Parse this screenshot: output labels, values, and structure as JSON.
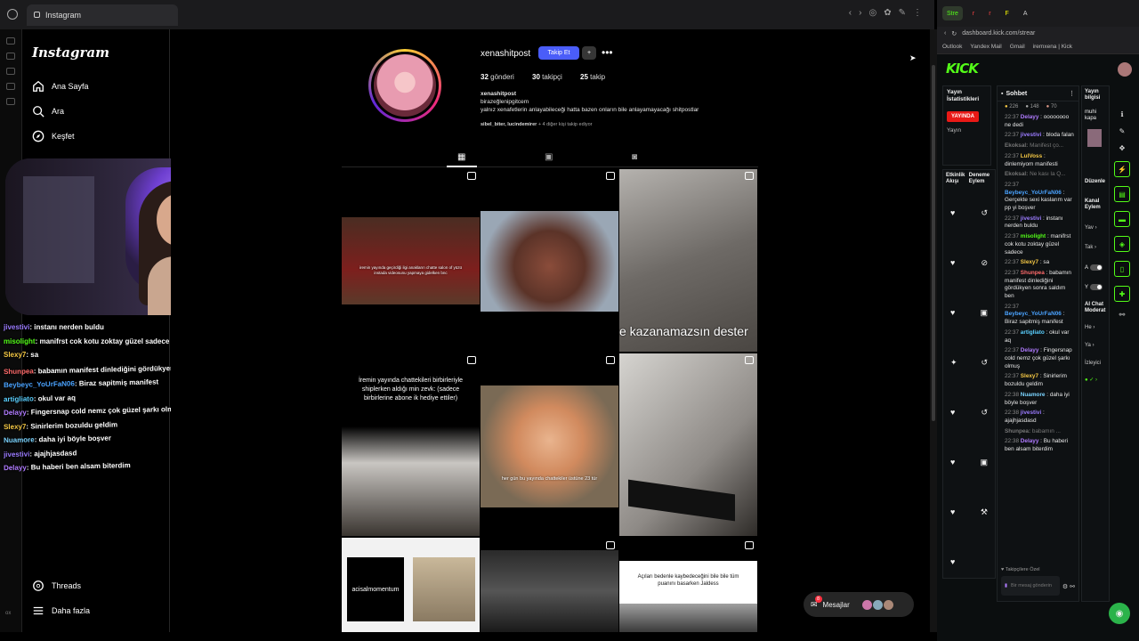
{
  "browser": {
    "tab_title": "Instagram"
  },
  "ig": {
    "logo": "Instagram",
    "nav": [
      "Ana Sayfa",
      "Ara",
      "Keşfet"
    ],
    "nav_bottom": [
      "Threads",
      "Daha fazla"
    ],
    "username": "xenashitpost",
    "follow_btn": "Takip Et",
    "stats": {
      "posts": "32",
      "posts_label": "gönderi",
      "followers": "30",
      "followers_label": "takipçi",
      "following": "25",
      "following_label": "takip"
    },
    "bio_name": "xenashitpost",
    "bio_lines": [
      "birazeğlenipgitcem",
      "yalnız xenafetlerin anlayabileceği hatta bazen onların bile anlayamayacağı shitpostlar"
    ],
    "followed_by_names": "sibel_biter, lucindemirer",
    "followed_by_rest": "+ 4 diğer kişi takip ediyor",
    "messages": "Mesajlar",
    "messages_badge": "8"
  },
  "posts": {
    "p1_cap": "iremin yayında geçirdiği ilgi anakların chatte salon of yüzü instada videosunu yapmaya gidelken bnc",
    "p3_cap": "e kazanamazsın dester",
    "p4_cap": "İremin yayında chattekileri birbirleriyle shiplerken aldığı min zevk: (sadece birbirlerine abone ik hediye ettiler)",
    "p5_cap": "her gün bu yayında chattekiler üstüne 23 tür",
    "p7_cap": "acisalmomentum",
    "p9_cap": "Açıları bedenle kaybedeceğini bile bile tüm puanını basarken Jaldess"
  },
  "overlay_chat": [
    {
      "user": "jivestivi",
      "text": ": instanı nerden buldu",
      "color": "#9b7bff"
    },
    {
      "user": "misolight",
      "text": ": manifrst cok kotu zoktay güzel sadece",
      "color": "#53fc18"
    },
    {
      "user": "Slexy7",
      "text": ": sa",
      "color": "#f6c945"
    },
    {
      "user": "Shunpea",
      "text": ": babamın manifest dinlediğini gördükyen sonra saldım ben",
      "color": "#ff6b6b"
    },
    {
      "user": "Beybeyc_YoUrFaN06",
      "text": ": Biraz sapitmiş manifest",
      "color": "#4aa3ff"
    },
    {
      "user": "artigliato",
      "text": ": okul var aq",
      "color": "#5ad0ff"
    },
    {
      "user": "Delayy",
      "text": ": Fingersnap cold nemz çok güzel şarkı olmuş",
      "color": "#b07bff"
    },
    {
      "user": "Slexy7",
      "text": ": Sinirlerim bozuldu geldim",
      "color": "#f6c945"
    },
    {
      "user": "Nuamore",
      "text": ": daha iyi böyle boşver",
      "color": "#7bd4ff"
    },
    {
      "user": "jivestivi",
      "text": ": ajajhjasdasd",
      "color": "#9b7bff"
    },
    {
      "user": "Delayy",
      "text": ": Bu haberi ben alsam biterdim",
      "color": "#b07bff"
    }
  ],
  "kick": {
    "tabs": [
      "Stre",
      "r",
      "r",
      "F",
      "A"
    ],
    "url": "dashboard.kick.com/strear",
    "bookmarks": [
      "Outlook",
      "Yandex Mail",
      "Gmail",
      "iremxena | Kick"
    ],
    "logo": "KICK",
    "stats_title": "Yayın İstatistikleri",
    "live": "YAYINDA",
    "yayin": "Yayın",
    "events_title": "Etkinlik Akışı",
    "events_title2": "Deneme Eylem",
    "chat_title": "Sohbet",
    "viewers": [
      "226",
      "148",
      "70"
    ],
    "info_title": "Yayın bilgisi",
    "info_sub": "muhi kapa",
    "duzenle": "Düzenle",
    "channel_actions": "Kanal Eylem",
    "rows": [
      "Yav",
      "Tak",
      "A",
      "Y"
    ],
    "ai_chat": "AI Chat Moderat",
    "he": "He",
    "ya": "Ya",
    "izleyici": "İzleyici",
    "followers_only": "Takipçilere Özel",
    "send_hint": "Bir mesaj gönderin",
    "chat": [
      {
        "t": "22:37",
        "u": "Delayy",
        "m": ": oooooooo ne dedi",
        "c": "#b07bff"
      },
      {
        "t": "22:37",
        "u": "jivestivi",
        "m": ": bloda falan",
        "c": "#9b7bff"
      },
      {
        "t": "",
        "u": "Ekoksal:",
        "m": "Manifest ço...",
        "c": "#777"
      },
      {
        "t": "22:37",
        "u": "LulVoss",
        "m": ": dinlemiyom manifesti",
        "c": "#f6c945"
      },
      {
        "t": "",
        "u": "Ekoksal:",
        "m": "Ne kası la Q...",
        "c": "#777"
      },
      {
        "t": "22:37",
        "u": "Beybeyc_YoUrFaN06",
        "m": ": Gerçekte sexi kaslarım var pp yi boşver",
        "c": "#4aa3ff"
      },
      {
        "t": "22:37",
        "u": "jivestivi",
        "m": ": instanı nerden buldu",
        "c": "#9b7bff"
      },
      {
        "t": "22:37",
        "u": "misolight",
        "m": ": manifrst cok kotu zoktay güzel sadece",
        "c": "#53fc18"
      },
      {
        "t": "22:37",
        "u": "Slexy7",
        "m": ": sa",
        "c": "#f6c945"
      },
      {
        "t": "22:37",
        "u": "Shunpea",
        "m": ": babamın manifest dinlediğini gördükyen sonra saldım ben",
        "c": "#ff6b6b"
      },
      {
        "t": "22:37",
        "u": "Beybeyc_YoUrFaN06",
        "m": ": Biraz sapitmiş manifest",
        "c": "#4aa3ff"
      },
      {
        "t": "22:37",
        "u": "artigliato",
        "m": ": okul var aq",
        "c": "#5ad0ff"
      },
      {
        "t": "22:37",
        "u": "Delayy",
        "m": ": Fingersnap cold nemz çok güzel şarkı olmuş",
        "c": "#b07bff"
      },
      {
        "t": "22:37",
        "u": "Slexy7",
        "m": ": Sinirlerim bozuldu geldim",
        "c": "#f6c945"
      },
      {
        "t": "22:38",
        "u": "Nuamore",
        "m": ": daha iyi böyle boşver",
        "c": "#7bd4ff"
      },
      {
        "t": "22:38",
        "u": "jivestivi",
        "m": ": ajajhjasdasd",
        "c": "#9b7bff"
      },
      {
        "t": "",
        "u": "Shunpea:",
        "m": "babamın ...",
        "c": "#777"
      },
      {
        "t": "22:38",
        "u": "Delayy",
        "m": ": Bu haberi ben alsam biterdim",
        "c": "#b07bff"
      }
    ]
  },
  "colors": {
    "kick_green": "#53fc18",
    "ig_blue": "#4a5df9",
    "live_red": "#e91916"
  }
}
